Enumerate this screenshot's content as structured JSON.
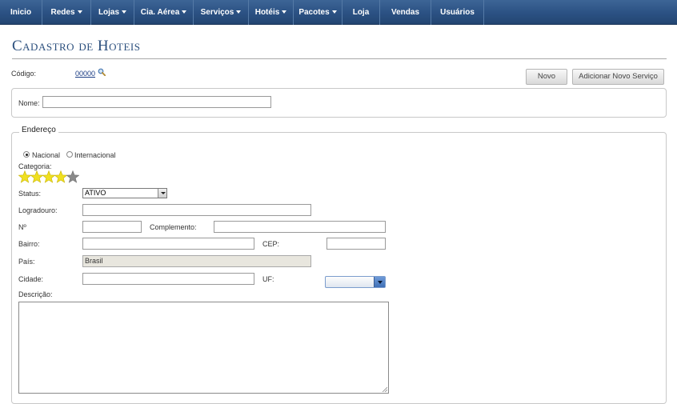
{
  "nav": {
    "items": [
      {
        "label": "Inicio",
        "dropdown": false
      },
      {
        "label": "Redes",
        "dropdown": true
      },
      {
        "label": "Lojas",
        "dropdown": true
      },
      {
        "label": "Cia. Aérea",
        "dropdown": true
      },
      {
        "label": "Serviços",
        "dropdown": true
      },
      {
        "label": "Hotéis",
        "dropdown": true
      },
      {
        "label": "Pacotes",
        "dropdown": true
      },
      {
        "label": "Loja",
        "dropdown": false
      },
      {
        "label": "Vendas",
        "dropdown": false
      },
      {
        "label": "Usuários",
        "dropdown": false
      }
    ]
  },
  "page": {
    "title": "Cadastro de Hoteis"
  },
  "code": {
    "label": "Código:",
    "value": "00000"
  },
  "buttons": {
    "novo": "Novo",
    "adicionar": "Adicionar Novo Serviço"
  },
  "name_field": {
    "label": "Nome:",
    "value": ""
  },
  "endereco": {
    "legend": "Endereço",
    "radio_nacional": "Nacional",
    "radio_internacional": "Internacional",
    "selected_radio": "Nacional",
    "categoria_label": "Categoria:",
    "rating": 4,
    "rating_max": 5,
    "status_label": "Status:",
    "status_value": "ATIVO",
    "logradouro_label": "Logradouro:",
    "numero_label": "Nº",
    "complemento_label": "Complemento:",
    "bairro_label": "Bairro:",
    "cep_label": "CEP:",
    "pais_label": "País:",
    "pais_value": "Brasil",
    "cidade_label": "Cidade:",
    "uf_label": "UF:",
    "uf_value": "",
    "descricao_label": "Descrição:"
  },
  "colors": {
    "nav": "#2b5183",
    "title": "#2b4f7d",
    "star_on": "#f0e020",
    "star_off": "#8a8a8a"
  }
}
